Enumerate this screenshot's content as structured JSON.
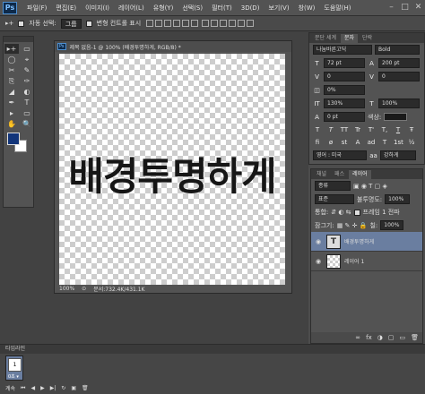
{
  "menubar": {
    "logo": "Ps",
    "items": [
      "파일(F)",
      "편집(E)",
      "이미지(I)",
      "레이어(L)",
      "유형(Y)",
      "선택(S)",
      "필터(T)",
      "3D(D)",
      "보기(V)",
      "창(W)",
      "도움말(H)"
    ],
    "window_controls": [
      "–",
      "□",
      "✕"
    ]
  },
  "options_bar": {
    "tool_glyph": "▸+",
    "auto_select_label": "자동 선택:",
    "auto_select_value": "그룹",
    "transform_controls_label": "변형 컨트롤 표시"
  },
  "document": {
    "tab_logo": "Ps",
    "title": "제목 없음-1 @ 100% (배경투명하게, RGB/8) *",
    "close_glyph": "×",
    "canvas_text": "배경투명하게",
    "zoom": "100%",
    "file_info": "문서:732.4K/431.1K"
  },
  "character_panel": {
    "tabs": [
      "문단 세계",
      "문자",
      "단락"
    ],
    "font_family": "나눔바른고딕",
    "font_style": "Bold",
    "font_size": "72 pt",
    "leading": "200 pt",
    "kerning": "0",
    "tracking": "0",
    "percent": "0%",
    "vertical_scale": "130%",
    "horizontal_scale": "100%",
    "baseline_shift": "0 pt",
    "color_label": "색상:",
    "style_buttons": [
      "T",
      "T",
      "TT",
      "Tr",
      "T'",
      "T,",
      "T",
      "Ŧ"
    ],
    "extra_buttons": [
      "fi",
      "ø",
      "st",
      "A",
      "ad",
      "T",
      "1st",
      "½"
    ],
    "language": "영어 : 미국",
    "antialias_glyph": "aa",
    "antialias": "강하게"
  },
  "layers_panel": {
    "tabs": [
      "채널",
      "패스",
      "레이어"
    ],
    "filter_label": "종류",
    "blend_mode": "표준",
    "opacity_label": "불투명도:",
    "opacity": "100%",
    "unify_label": "통합:",
    "propagate_label": "프레임 1 전파",
    "lock_label": "잠그기:",
    "fill_label": "칠:",
    "fill": "100%",
    "layers": [
      {
        "name": "배경투명하게",
        "type": "text",
        "selected": true,
        "thumb": "T"
      },
      {
        "name": "레이어 1",
        "type": "pixel",
        "selected": false,
        "thumb": ""
      }
    ],
    "footer_icons": [
      "∞",
      "fx",
      "◑",
      "▢",
      "▭",
      "🗑"
    ]
  },
  "timeline": {
    "title": "타임라인",
    "frame_number": "1",
    "frame_delay": "0초 ▾",
    "loop": "계속",
    "controls": [
      "⏮",
      "◀",
      "▶",
      "▶|",
      "↻",
      "▣",
      "🗑"
    ]
  },
  "tools": [
    "▸+",
    "▭",
    "◯",
    "⌖",
    "✂",
    "✎",
    "⎘",
    "✑",
    "◢",
    "◐",
    "✒",
    "T",
    "▸",
    "▭",
    "✋",
    "🔍"
  ],
  "colors": {
    "foreground": "#12357a",
    "background": "#ffffff",
    "accent_selection": "#6a7ea0"
  }
}
